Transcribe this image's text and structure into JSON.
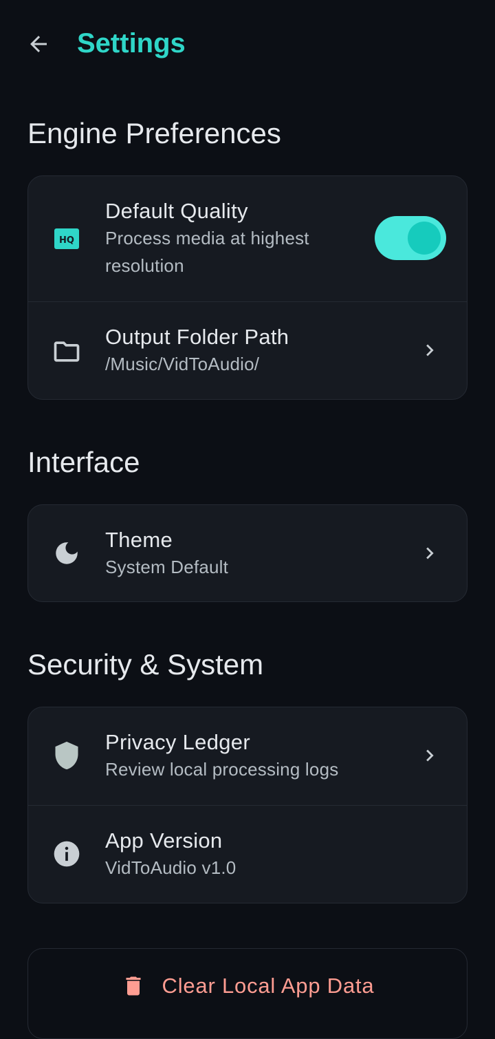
{
  "header": {
    "back_icon": "arrow-left-icon",
    "title": "Settings"
  },
  "colors": {
    "accent": "#2fd6c8",
    "background": "#0c0f15",
    "card": "#161a21",
    "danger": "#ff9d92"
  },
  "sections": {
    "engine": {
      "title": "Engine Preferences",
      "quality": {
        "icon": "hq-icon",
        "title": "Default Quality",
        "subtitle": "Process media at highest resolution",
        "toggle_on": true
      },
      "output": {
        "icon": "folder-icon",
        "title": "Output Folder Path",
        "subtitle": "/Music/VidToAudio/"
      }
    },
    "interface": {
      "title": "Interface",
      "theme": {
        "icon": "moon-icon",
        "title": "Theme",
        "subtitle": "System Default"
      }
    },
    "security": {
      "title": "Security & System",
      "privacy": {
        "icon": "shield-icon",
        "title": "Privacy Ledger",
        "subtitle": "Review local processing logs"
      },
      "version": {
        "icon": "info-icon",
        "title": "App Version",
        "subtitle": "VidToAudio v1.0"
      }
    }
  },
  "danger": {
    "icon": "trash-icon",
    "label": "Clear Local App Data"
  }
}
